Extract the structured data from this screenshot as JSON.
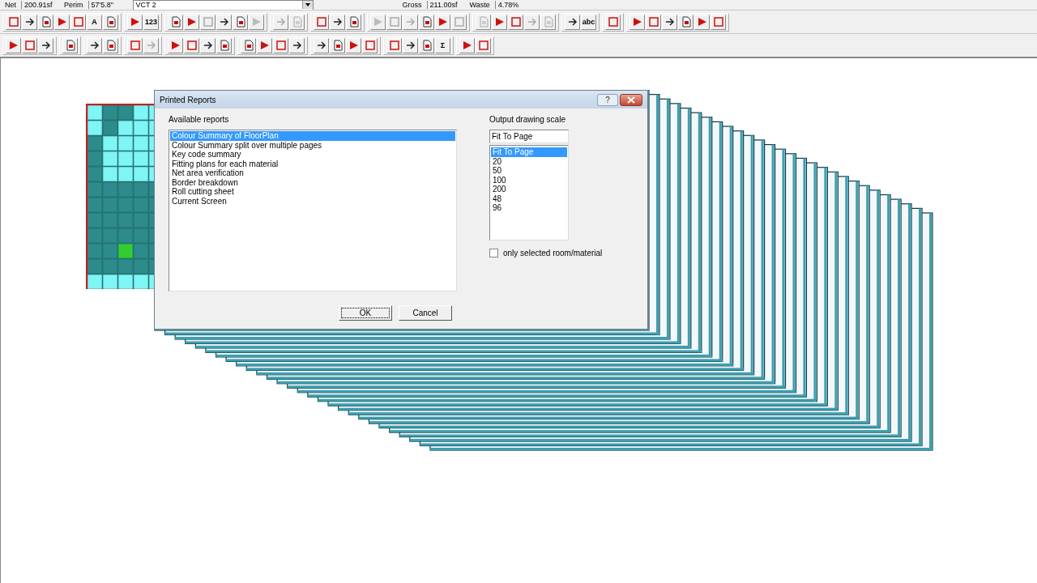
{
  "status_fields": [
    {
      "label": "Net",
      "value": "200.91sf"
    },
    {
      "label": "Perim",
      "value": "57'5.8\""
    }
  ],
  "material_dropdown": {
    "value": "VCT 2"
  },
  "totals": [
    {
      "label": "Gross",
      "value": "211.00sf"
    },
    {
      "label": "Waste",
      "value": "4.78%"
    }
  ],
  "toolbars": [
    {
      "groups": [
        [
          {
            "disabled": false
          },
          {
            "disabled": false
          },
          {
            "disabled": false
          },
          {
            "disabled": false
          },
          {
            "disabled": false
          },
          {
            "label": "A",
            "disabled": false
          },
          {
            "disabled": false
          }
        ],
        [
          {
            "disabled": false
          },
          {
            "label": "123",
            "disabled": false
          }
        ],
        [
          {
            "disabled": false
          },
          {
            "disabled": false
          },
          {
            "disabled": true
          },
          {
            "disabled": false
          },
          {
            "disabled": false
          },
          {
            "disabled": true
          }
        ],
        [
          {
            "disabled": true
          },
          {
            "disabled": true
          }
        ],
        [
          {
            "disabled": false
          },
          {
            "disabled": false
          },
          {
            "disabled": false
          }
        ],
        [
          {
            "disabled": true
          },
          {
            "disabled": true
          },
          {
            "disabled": true
          },
          {
            "disabled": false
          },
          {
            "disabled": false
          },
          {
            "disabled": true
          }
        ],
        [
          {
            "disabled": true
          },
          {
            "disabled": false
          },
          {
            "disabled": false
          },
          {
            "disabled": true
          },
          {
            "disabled": true
          }
        ],
        [
          {
            "disabled": false
          },
          {
            "label": "abc",
            "disabled": false
          }
        ],
        [
          {
            "disabled": false
          }
        ],
        [
          {
            "disabled": false
          },
          {
            "disabled": false
          },
          {
            "disabled": false
          },
          {
            "disabled": false
          },
          {
            "disabled": false
          },
          {
            "disabled": false
          }
        ]
      ]
    },
    {
      "groups": [
        [
          {
            "disabled": false
          },
          {
            "disabled": false
          },
          {
            "disabled": false
          }
        ],
        [
          {
            "disabled": false
          }
        ],
        [
          {
            "disabled": false
          },
          {
            "disabled": false
          }
        ],
        [
          {
            "disabled": false
          },
          {
            "disabled": true
          }
        ],
        [
          {
            "disabled": false
          },
          {
            "disabled": false
          },
          {
            "disabled": false
          },
          {
            "disabled": false
          }
        ],
        [
          {
            "disabled": false
          },
          {
            "disabled": false
          },
          {
            "disabled": false
          },
          {
            "disabled": false
          }
        ],
        [
          {
            "disabled": false
          },
          {
            "disabled": false
          },
          {
            "disabled": false
          },
          {
            "disabled": false
          }
        ],
        [
          {
            "disabled": false
          },
          {
            "disabled": false
          },
          {
            "disabled": false
          },
          {
            "label": "Σ",
            "disabled": false
          }
        ],
        [
          {
            "disabled": false
          },
          {
            "disabled": false
          }
        ]
      ]
    }
  ],
  "dialog": {
    "title": "Printed Reports",
    "help": "?",
    "reports_label": "Available reports",
    "reports": [
      {
        "label": "Colour Summary of FloorPlan",
        "selected": true
      },
      {
        "label": "Colour Summary split over multiple pages",
        "selected": false
      },
      {
        "label": "Key code summary",
        "selected": false
      },
      {
        "label": "Fitting plans for each material",
        "selected": false
      },
      {
        "label": "Net area verification",
        "selected": false
      },
      {
        "label": "Border breakdown",
        "selected": false
      },
      {
        "label": "Roll cutting sheet",
        "selected": false
      },
      {
        "label": "Current Screen",
        "selected": false
      }
    ],
    "scale_label": "Output drawing scale",
    "scale_value": "Fit To Page",
    "scales": [
      {
        "label": "Fit To Page",
        "selected": true
      },
      {
        "label": "20",
        "selected": false
      },
      {
        "label": "50",
        "selected": false
      },
      {
        "label": "100",
        "selected": false
      },
      {
        "label": "200",
        "selected": false
      },
      {
        "label": "48",
        "selected": false
      },
      {
        "label": "96",
        "selected": false
      }
    ],
    "checkbox": {
      "label": "only selected room/material",
      "checked": false
    },
    "buttons": [
      "OK",
      "Cancel"
    ]
  }
}
